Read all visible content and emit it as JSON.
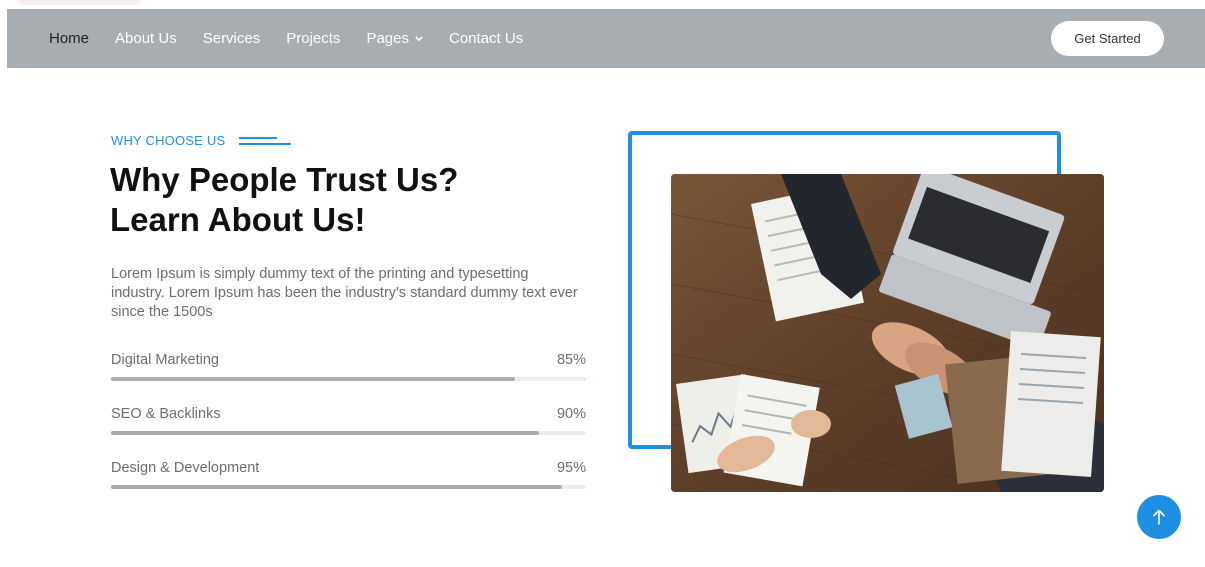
{
  "nav": {
    "items": [
      {
        "label": "Home",
        "active": true
      },
      {
        "label": "About Us",
        "active": false
      },
      {
        "label": "Services",
        "active": false
      },
      {
        "label": "Projects",
        "active": false
      },
      {
        "label": "Pages",
        "active": false,
        "dropdown": true
      },
      {
        "label": "Contact Us",
        "active": false
      }
    ],
    "cta_label": "Get Started"
  },
  "section": {
    "eyebrow": "WHY CHOOSE US",
    "title_line1": "Why People Trust Us?",
    "title_line2": "Learn About Us!",
    "description": "Lorem Ipsum is simply dummy text of the printing and typesetting industry. Lorem Ipsum has been the industry's standard dummy text ever since the 1500s"
  },
  "skills": [
    {
      "label": "Digital Marketing",
      "percent_text": "85%",
      "value": 85
    },
    {
      "label": "SEO & Backlinks",
      "percent_text": "90%",
      "value": 90
    },
    {
      "label": "Design & Development",
      "percent_text": "95%",
      "value": 95
    }
  ],
  "icons": {
    "dropdown": "chevron-down-icon",
    "scroll_top": "arrow-up-icon"
  },
  "colors": {
    "accent": "#1e8fe3",
    "navbar": "#a7adb0",
    "progress_fill": "#a9aeb2",
    "progress_track": "#e8edf2"
  }
}
